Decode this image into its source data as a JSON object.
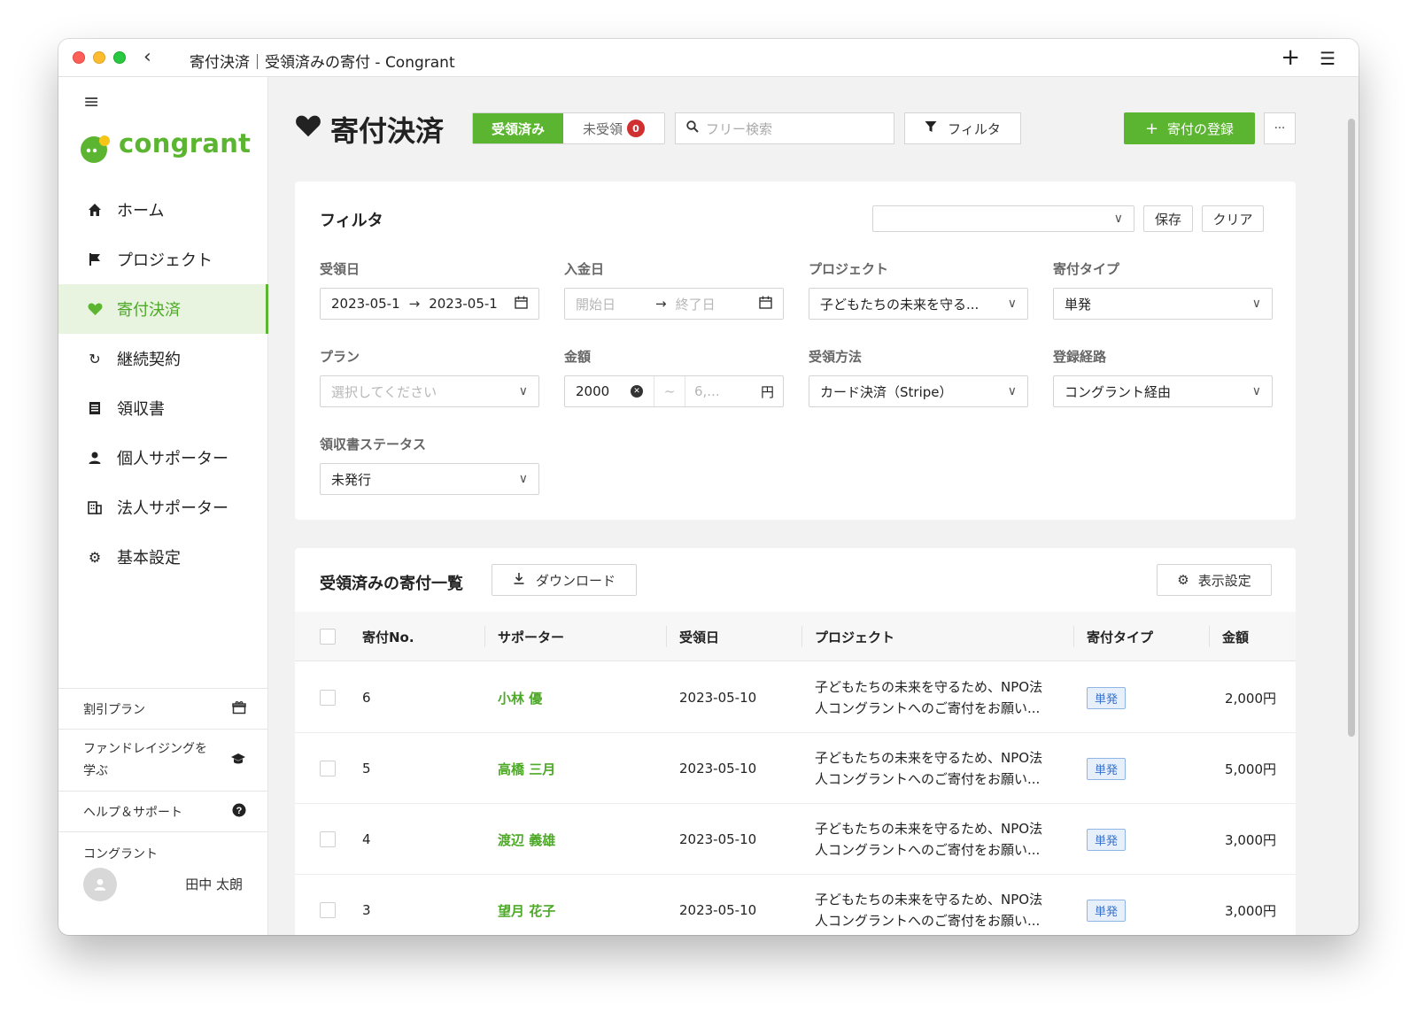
{
  "window": {
    "title": "寄付決済｜受領済みの寄付 - Congrant"
  },
  "sidebar": {
    "brand": "congrant",
    "items": [
      {
        "label": "ホーム",
        "icon": "home-icon",
        "active": false
      },
      {
        "label": "プロジェクト",
        "icon": "flag-icon",
        "active": false
      },
      {
        "label": "寄付決済",
        "icon": "heart-icon",
        "active": true
      },
      {
        "label": "継続契約",
        "icon": "refresh-icon",
        "active": false
      },
      {
        "label": "領収書",
        "icon": "receipt-icon",
        "active": false
      },
      {
        "label": "個人サポーター",
        "icon": "person-icon",
        "active": false
      },
      {
        "label": "法人サポーター",
        "icon": "building-icon",
        "active": false
      },
      {
        "label": "基本設定",
        "icon": "gear-icon",
        "active": false
      }
    ],
    "bottom": {
      "discount": "割引プラン",
      "learn": "ファンドレイジングを学ぶ",
      "help": "ヘルプ＆サポート",
      "org": "コングラント",
      "user": "田中 太朗"
    }
  },
  "header": {
    "title": "寄付決済",
    "tab_received": "受領済み",
    "tab_unreceived": "未受領",
    "unreceived_count": "0",
    "search_placeholder": "フリー検索",
    "filter_label": "フィルタ",
    "add_label": "寄付の登録",
    "more_label": "···"
  },
  "filter": {
    "title": "フィルタ",
    "save": "保存",
    "clear": "クリア",
    "received_date": {
      "label": "受領日",
      "start": "2023-05-1",
      "end": "2023-05-1"
    },
    "deposit_date": {
      "label": "入金日",
      "start_ph": "開始日",
      "end_ph": "終了日"
    },
    "project": {
      "label": "プロジェクト",
      "value": "子どもたちの未来を守る..."
    },
    "donation_type": {
      "label": "寄付タイプ",
      "value": "単発"
    },
    "plan": {
      "label": "プラン",
      "placeholder": "選択してください"
    },
    "amount": {
      "label": "金額",
      "min": "2000",
      "tilde": "~",
      "max_ph": "6,...",
      "unit": "円"
    },
    "method": {
      "label": "受領方法",
      "value": "カード決済（Stripe）"
    },
    "route": {
      "label": "登録経路",
      "value": "コングラント経由"
    },
    "receipt_status": {
      "label": "領収書ステータス",
      "value": "未発行"
    }
  },
  "list": {
    "title": "受領済みの寄付一覧",
    "download": "ダウンロード",
    "display_settings": "表示設定",
    "columns": [
      "寄付No.",
      "サポーター",
      "受領日",
      "プロジェクト",
      "寄付タイプ",
      "金額"
    ],
    "rows": [
      {
        "no": "6",
        "supporter": "小林 優",
        "date": "2023-05-10",
        "project_line1": "子どもたちの未来を守るため、NPO法",
        "project_line2": "人コングラントへのご寄付をお願い...",
        "type": "単発",
        "amount": "2,000円"
      },
      {
        "no": "5",
        "supporter": "高橋 三月",
        "date": "2023-05-10",
        "project_line1": "子どもたちの未来を守るため、NPO法",
        "project_line2": "人コングラントへのご寄付をお願い...",
        "type": "単発",
        "amount": "5,000円"
      },
      {
        "no": "4",
        "supporter": "渡辺 義雄",
        "date": "2023-05-10",
        "project_line1": "子どもたちの未来を守るため、NPO法",
        "project_line2": "人コングラントへのご寄付をお願い...",
        "type": "単発",
        "amount": "3,000円"
      },
      {
        "no": "3",
        "supporter": "望月 花子",
        "date": "2023-05-10",
        "project_line1": "子どもたちの未来を守るため、NPO法",
        "project_line2": "人コングラントへのご寄付をお願い...",
        "type": "単発",
        "amount": "3,000円"
      }
    ]
  },
  "colors": {
    "brand_green": "#5cb531",
    "badge_red": "#d0302f",
    "type_badge_blue": "#3470c8"
  }
}
